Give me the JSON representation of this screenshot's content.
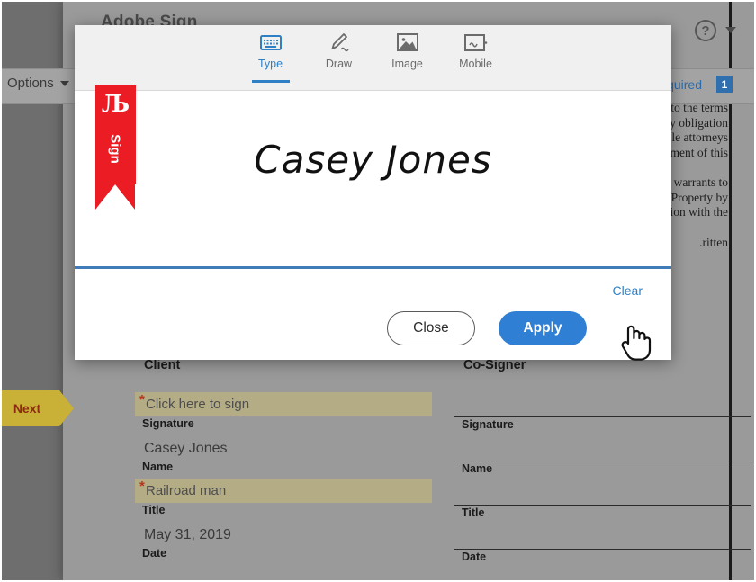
{
  "app": {
    "title": "Adobe Sign",
    "help_icon": "?",
    "options_label": "Options",
    "required_label": "Required",
    "required_count": "1",
    "next_label": "Next"
  },
  "document_text": {
    "lines": [
      "any to the terms",
      "of any obligation",
      "nable attorneys",
      "orcement of this",
      "ally warrants to",
      "to  Property by",
      "ection  with  the",
      "ritten."
    ]
  },
  "modal": {
    "tabs": [
      {
        "label": "Type",
        "icon": "keyboard-icon",
        "active": true
      },
      {
        "label": "Draw",
        "icon": "pen-icon",
        "active": false
      },
      {
        "label": "Image",
        "icon": "image-icon",
        "active": false
      },
      {
        "label": "Mobile",
        "icon": "mobile-icon",
        "active": false
      }
    ],
    "signature_value": "Casey Jones",
    "sign_flag": {
      "glyph": "Љ",
      "word": "Sign"
    },
    "clear_label": "Clear",
    "close_label": "Close",
    "apply_label": "Apply"
  },
  "form": {
    "client": {
      "title": "Client",
      "fields": [
        {
          "value": "Click here to sign",
          "label": "Signature",
          "filled": true,
          "required": true
        },
        {
          "value": "Casey Jones",
          "label": "Name",
          "filled": false,
          "required": false
        },
        {
          "value": "Railroad man",
          "label": "Title",
          "filled": true,
          "required": true
        },
        {
          "value": "May 31, 2019",
          "label": "Date",
          "filled": false,
          "required": false
        }
      ]
    },
    "cosigner": {
      "title": "Co-Signer",
      "fields": [
        {
          "value": "",
          "label": "Signature"
        },
        {
          "value": "",
          "label": "Name"
        },
        {
          "value": "",
          "label": "Title"
        },
        {
          "value": "",
          "label": "Date"
        }
      ]
    }
  },
  "colors": {
    "accent_blue": "#2f80d4",
    "link_blue": "#2f7fc4",
    "field_fill": "#b3ac85",
    "required_red": "#b5341a",
    "sign_red": "#ec1c24",
    "next_gold": "#c9b036"
  }
}
